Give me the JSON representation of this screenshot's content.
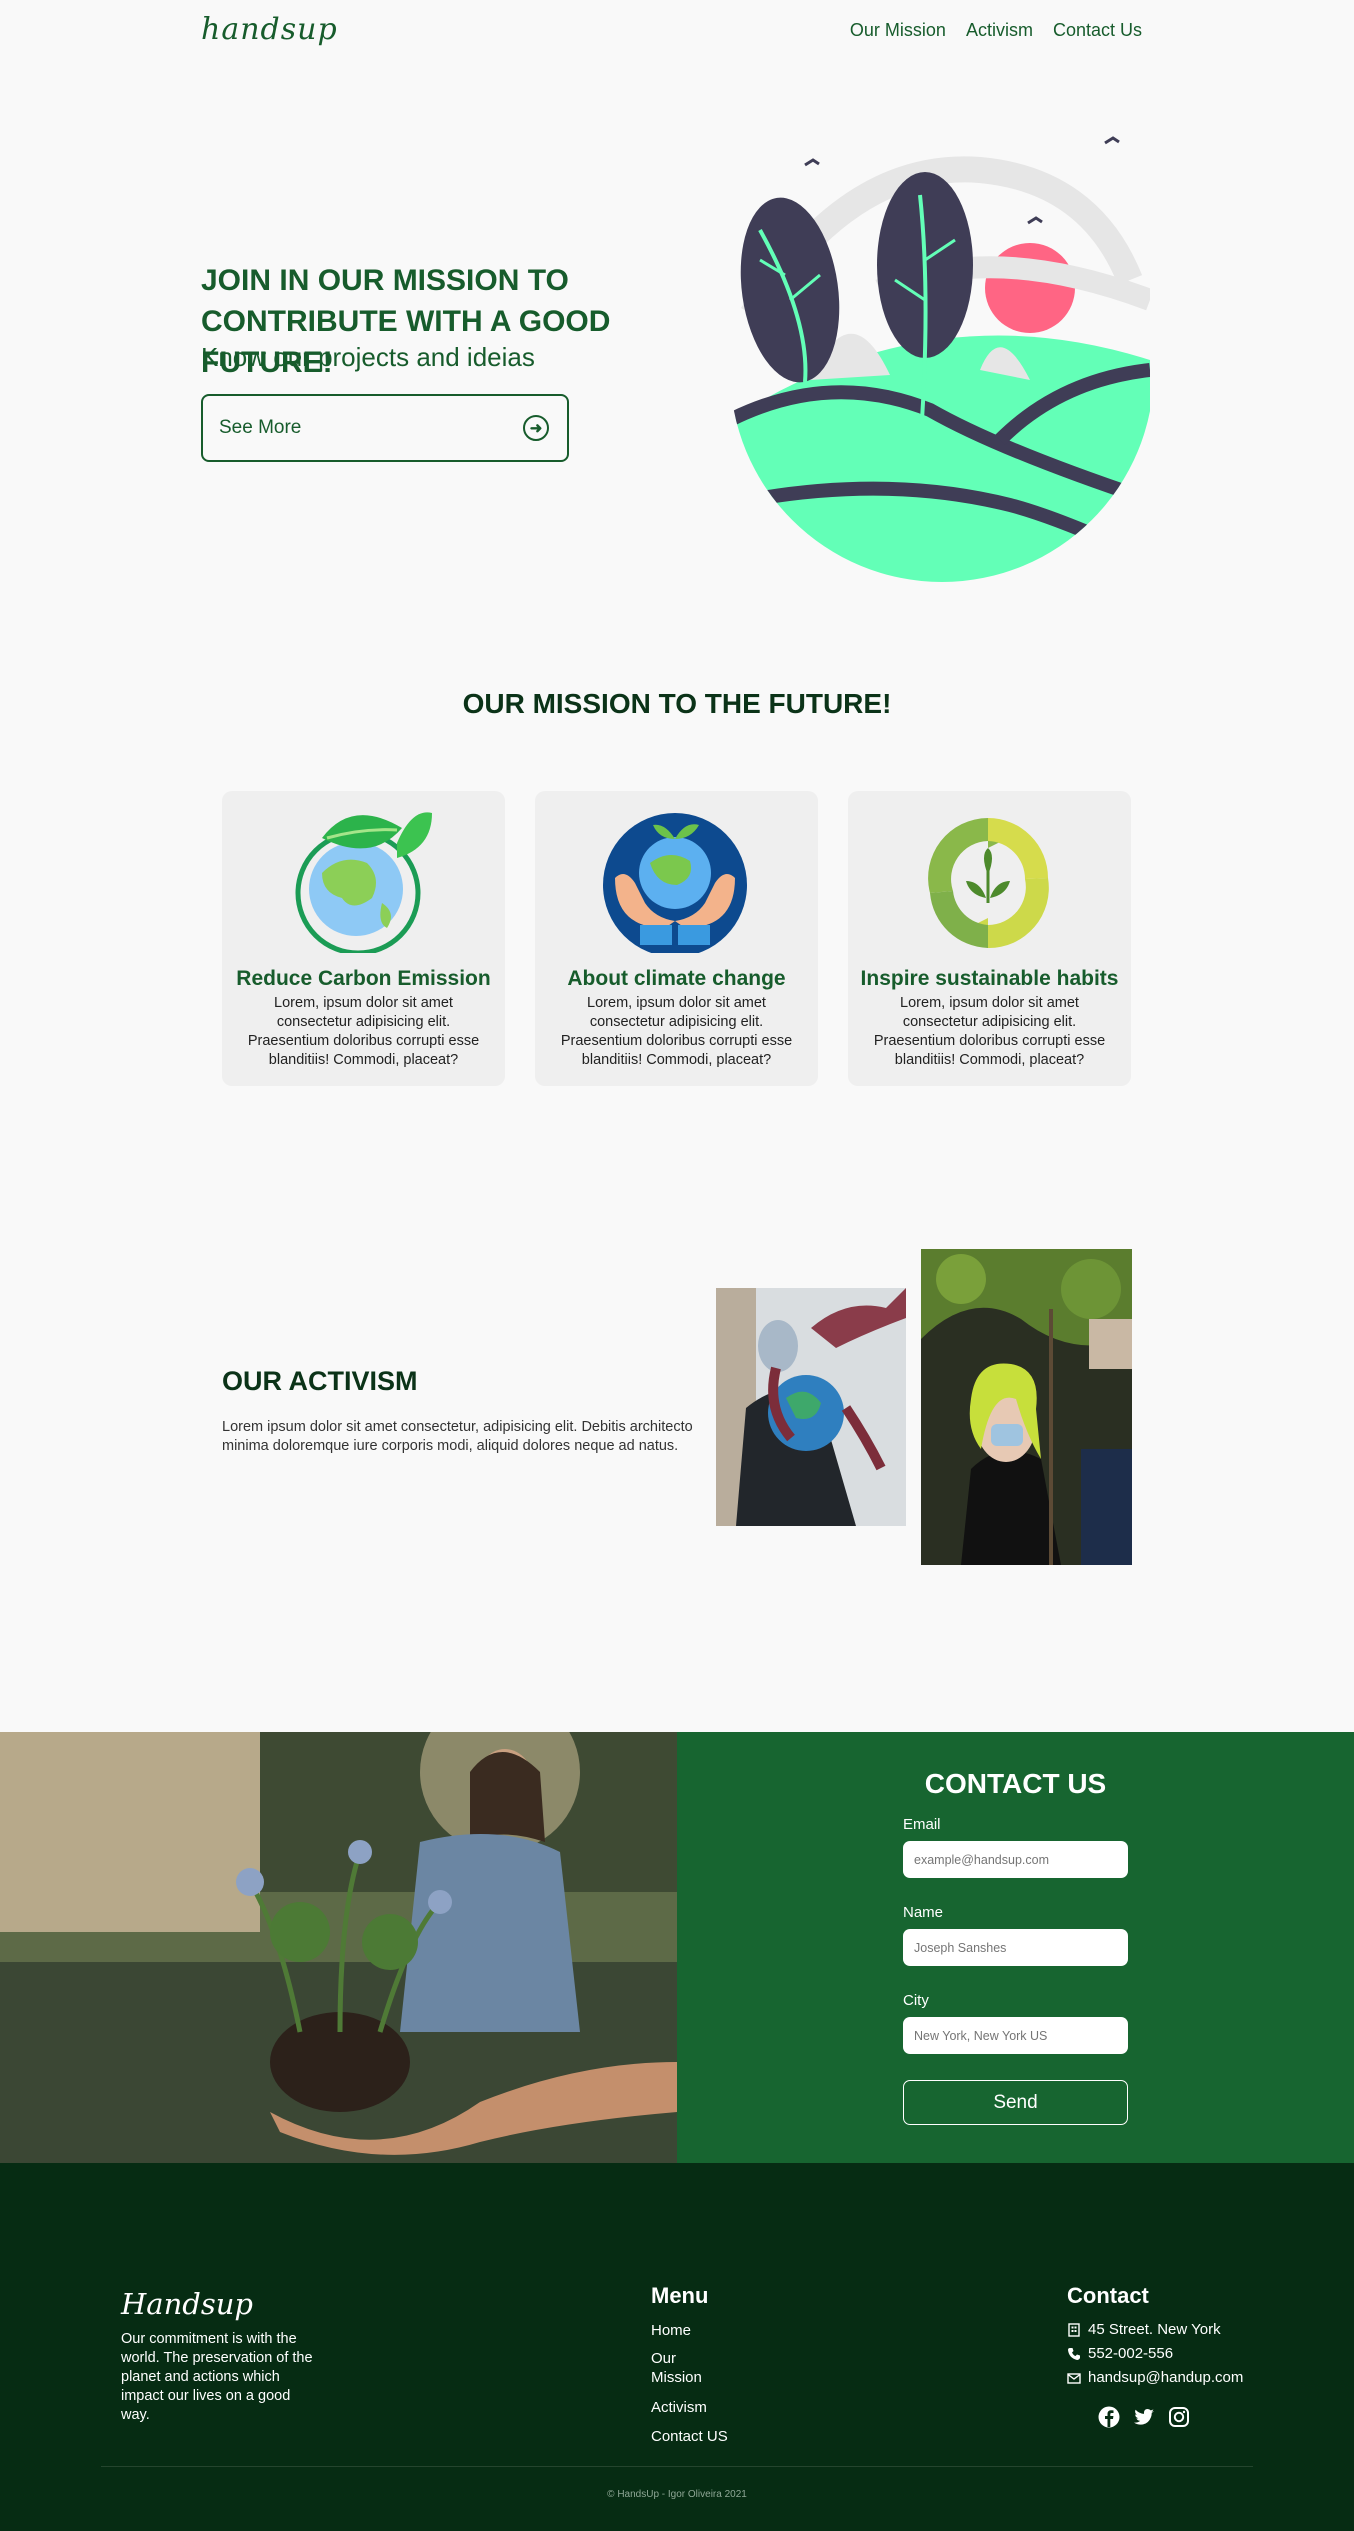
{
  "nav": {
    "logo": "handsup",
    "links": [
      "Our Mission",
      "Activism",
      "Contact Us"
    ]
  },
  "hero": {
    "title": "JOIN IN OUR MISSION TO CONTRIBUTE WITH A GOOD FUTURE!",
    "subtitle": "Know our projects and ideias",
    "button_label": "See More"
  },
  "mission": {
    "title": "OUR MISSION TO THE FUTURE!",
    "cards": [
      {
        "title": "Reduce Carbon Emission",
        "text": "Lorem, ipsum dolor sit amet consectetur adipisicing elit. Praesentium doloribus corrupti esse blanditiis! Commodi, placeat?",
        "icon": "earth-leaf-icon"
      },
      {
        "title": "About climate change",
        "text": "Lorem, ipsum dolor sit amet consectetur adipisicing elit. Praesentium doloribus corrupti esse blanditiis! Commodi, placeat?",
        "icon": "hands-earth-icon"
      },
      {
        "title": "Inspire sustainable habits",
        "text": "Lorem, ipsum dolor sit amet consectetur adipisicing elit. Praesentium doloribus corrupti esse blanditiis! Commodi, placeat?",
        "icon": "recycle-leaf-icon"
      }
    ]
  },
  "activism": {
    "title": "OUR ACTIVISM",
    "text": "Lorem ipsum dolor sit amet consectetur, adipisicing elit. Debitis architecto minima doloremque iure corporis modi, aliquid dolores neque ad natus."
  },
  "contact": {
    "title": "CONTACT US",
    "fields": [
      {
        "label": "Email",
        "placeholder": "example@handsup.com"
      },
      {
        "label": "Name",
        "placeholder": "Joseph Sanshes"
      },
      {
        "label": "City",
        "placeholder": "New York, New York US"
      }
    ],
    "send_label": "Send"
  },
  "footer": {
    "logo": "Handsup",
    "about": "Our commitment is with the world. The preservation of the planet and actions which impact our lives on a good way.",
    "menu_title": "Menu",
    "menu": [
      "Home",
      "Our Mission",
      "Activism",
      "Contact US"
    ],
    "contact_title": "Contact",
    "address": "45 Street. New York",
    "phone": "552-002-556",
    "email": "handsup@handup.com",
    "copyright": "© HandsUp - Igor Oliveira 2021"
  },
  "colors": {
    "brand": "#175c2c",
    "panel": "#176530",
    "footer": "#062c13",
    "mint": "#63ffb7",
    "navy": "#3f3d56",
    "pink": "#ff6584"
  }
}
